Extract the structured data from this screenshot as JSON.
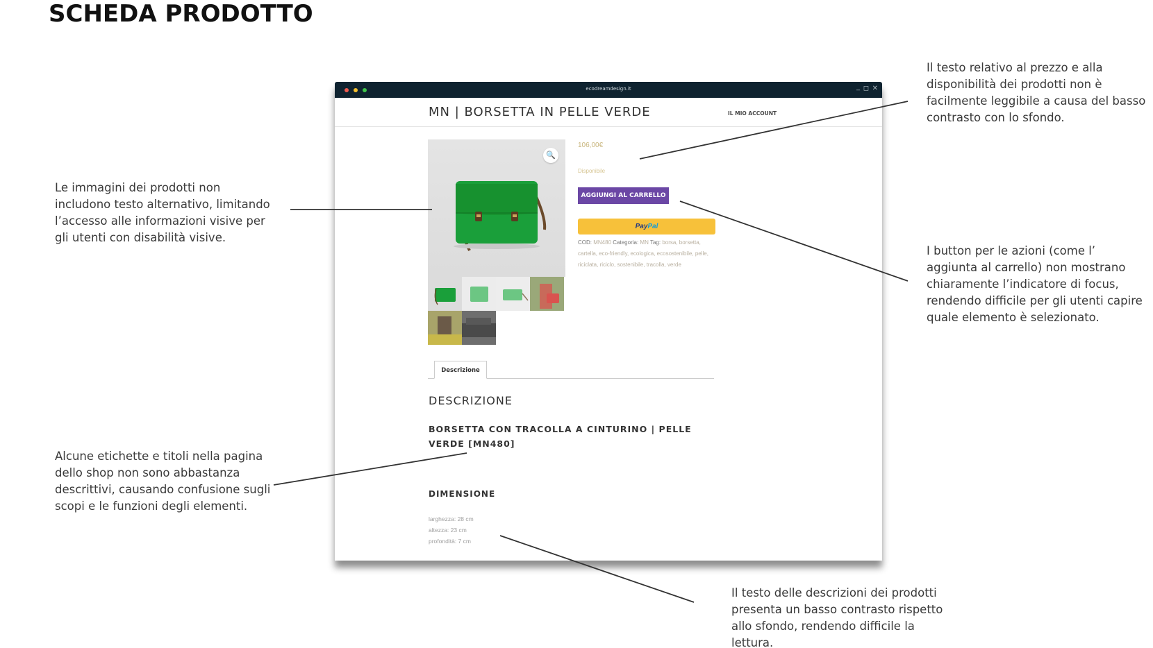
{
  "page_title": "SCHEDA PRODOTTO",
  "annotations": {
    "images_alt": "Le immagini dei prodotti non includono testo alternativo, limitando l’accesso alle informazioni visive per gli utenti con disabilità visive.",
    "price_contrast": "Il testo relativo al prezzo e alla disponibilità dei prodotti non è facilmente leggibile a causa del basso contrasto con lo sfondo.",
    "button_focus": "I button per le azioni (come l’ aggiunta al carrello) non mostrano chiaramente l’indicatore di focus, rendendo difficile per gli utenti capire quale elemento è selezionato.",
    "labels_titles": "Alcune etichette e titoli nella pagina dello shop non sono abbastanza descrittivi, causando confusione sugli scopi e le funzioni degli elementi.",
    "description_contrast": "Il testo delle descrizioni dei prodotti presenta un basso contrasto rispetto allo sfondo, rendendo difficile la lettura."
  },
  "browser": {
    "url": "ecodreamdesign.it",
    "controls": {
      "minimize": "_",
      "maximize": "◻",
      "close": "✕"
    }
  },
  "site": {
    "product_title": "MN | BORSETTA IN PELLE VERDE",
    "account_link": "IL MIO ACCOUNT"
  },
  "product": {
    "price": "106,00€",
    "availability": "Disponibile",
    "add_to_cart": "AGGIUNGI AL CARRELLO",
    "paypal_pay": "Pay",
    "paypal_pal": "Pal",
    "zoom_icon": "🔍",
    "meta_code_label": "COD:",
    "meta_code": "MN480",
    "meta_category_label": "Categoria:",
    "meta_category": "MN",
    "meta_tags_label": "Tag:",
    "meta_tags": "borsa, borsetta, cartella, eco-friendly, ecologica, ecosostenibile, pelle, riciclata, riciclo, sostenibile, tracolla, verde"
  },
  "tabs": {
    "description": "Descrizione"
  },
  "description": {
    "heading": "DESCRIZIONE",
    "product_name": "BORSETTA CON TRACOLLA A CINTURINO | PELLE VERDE [MN480]",
    "dimension_heading": "DIMENSIONE",
    "width": "larghezza: 28 cm",
    "height": "altezza: 23 cm",
    "depth": "profondità: 7 cm"
  },
  "colors": {
    "chrome_bar": "#0f2330",
    "add_to_cart_button": "#6b47a5",
    "paypal_button": "#f7c13a",
    "bag_green": "#1a9f3a",
    "price_text": "#c9b67e"
  }
}
